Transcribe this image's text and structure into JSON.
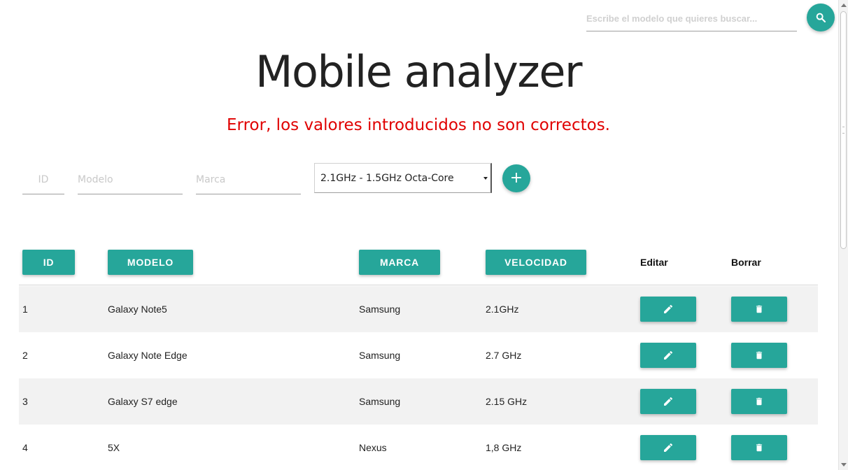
{
  "search": {
    "placeholder": "Escribe el modelo que quieres buscar..."
  },
  "header": {
    "title": "Mobile analyzer"
  },
  "error_message": "Error, los valores introducidos no son correctos.",
  "form": {
    "id_placeholder": "ID",
    "modelo_placeholder": "Modelo",
    "marca_placeholder": "Marca",
    "velocidad_selected": "2.1GHz - 1.5GHz Octa-Core",
    "add_label": "+"
  },
  "table": {
    "headers": {
      "id": "ID",
      "modelo": "MODELO",
      "marca": "MARCA",
      "velocidad": "VELOCIDAD",
      "editar": "Editar",
      "borrar": "Borrar"
    },
    "rows": [
      {
        "id": "1",
        "modelo": "Galaxy Note5",
        "marca": "Samsung",
        "velocidad": "2.1GHz"
      },
      {
        "id": "2",
        "modelo": "Galaxy Note Edge",
        "marca": "Samsung",
        "velocidad": "2.7 GHz"
      },
      {
        "id": "3",
        "modelo": "Galaxy S7 edge",
        "marca": "Samsung",
        "velocidad": "2.15 GHz"
      },
      {
        "id": "4",
        "modelo": "5X",
        "marca": "Nexus",
        "velocidad": "1,8 GHz"
      }
    ]
  },
  "colors": {
    "accent": "#26a69a",
    "error": "#e00000",
    "row_alt": "#f2f2f2"
  },
  "icons": {
    "search": "search-icon",
    "add": "plus-icon",
    "edit": "pencil-icon",
    "delete": "trash-icon"
  }
}
